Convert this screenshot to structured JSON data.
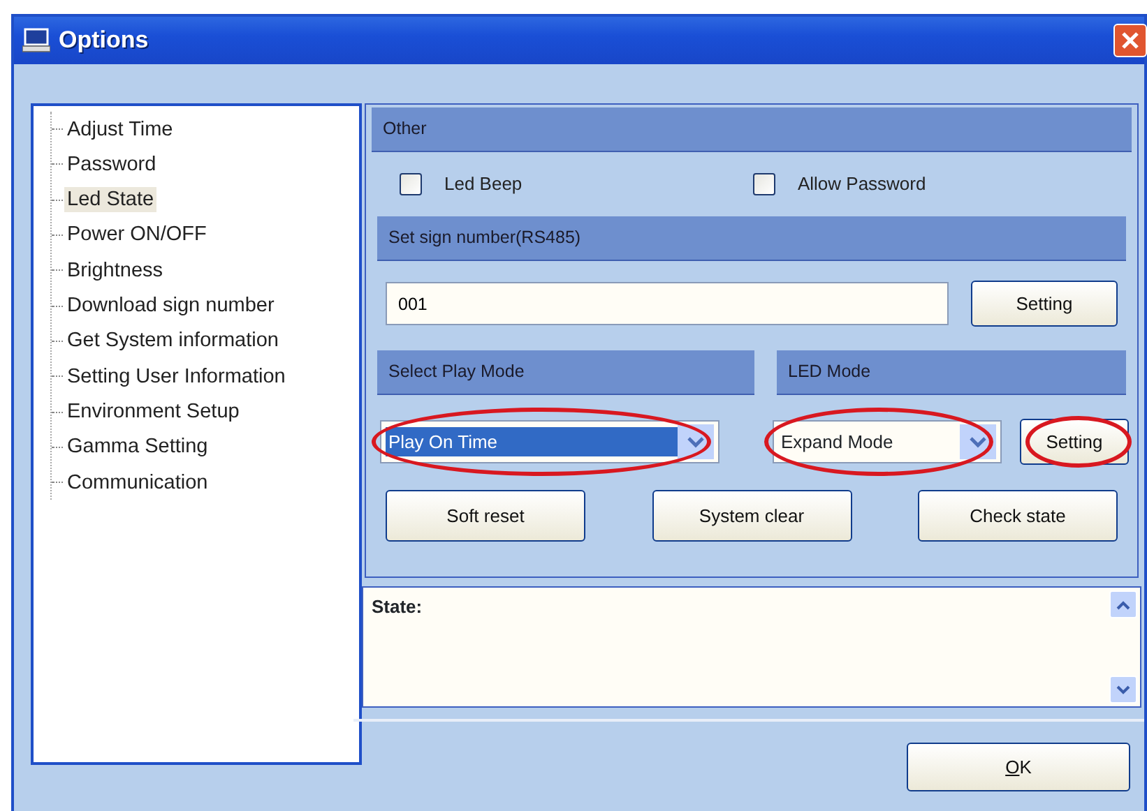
{
  "window": {
    "title": "Options"
  },
  "tree": [
    {
      "label": "Adjust Time",
      "selected": false
    },
    {
      "label": "Password",
      "selected": false
    },
    {
      "label": "Led State",
      "selected": true
    },
    {
      "label": "Power ON/OFF",
      "selected": false
    },
    {
      "label": "Brightness",
      "selected": false
    },
    {
      "label": "Download sign number",
      "selected": false
    },
    {
      "label": "Get System information",
      "selected": false
    },
    {
      "label": "Setting User Information",
      "selected": false
    },
    {
      "label": "Environment Setup",
      "selected": false
    },
    {
      "label": "Gamma Setting",
      "selected": false
    },
    {
      "label": "Communication",
      "selected": false
    }
  ],
  "other": {
    "header": "Other",
    "checkboxes": [
      {
        "label": "Led Beep",
        "checked": false
      },
      {
        "label": "Allow Password",
        "checked": false
      }
    ]
  },
  "sign_number": {
    "header": "Set sign number(RS485)",
    "value": "001",
    "button": "Setting"
  },
  "play_mode": {
    "header": "Select Play  Mode",
    "value": "Play On Time",
    "circled": true
  },
  "led_mode": {
    "header": "LED Mode",
    "value": "Expand Mode",
    "circled": true,
    "button": "Setting",
    "button_circled": true
  },
  "actions": [
    "Soft reset",
    "System clear",
    "Check state"
  ],
  "state_box": {
    "label": "State:"
  },
  "ok_button": "OK"
}
